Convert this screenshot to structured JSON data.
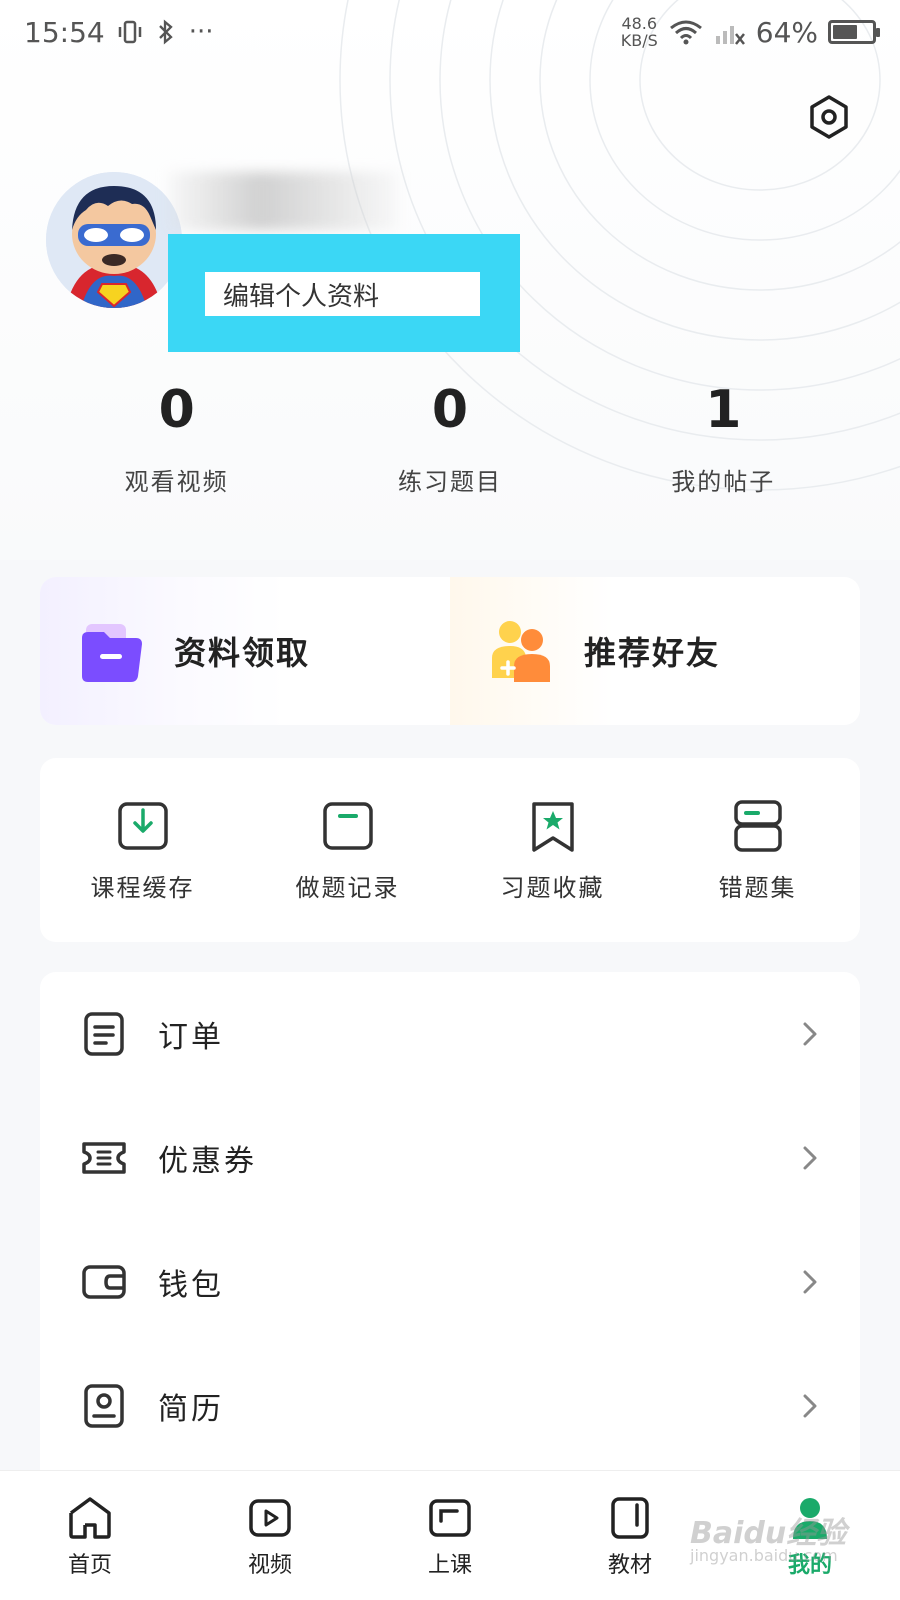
{
  "status_bar": {
    "time": "15:54",
    "more": "···",
    "net_speed_value": "48.6",
    "net_speed_unit": "KB/S",
    "battery_percent": "64%",
    "battery_level": 0.64
  },
  "profile": {
    "edit_label": "编辑个人资料"
  },
  "stats": [
    {
      "value": "0",
      "label": "观看视频"
    },
    {
      "value": "0",
      "label": "练习题目"
    },
    {
      "value": "1",
      "label": "我的帖子"
    }
  ],
  "promos": [
    {
      "label": "资料领取",
      "icon": "folder-icon"
    },
    {
      "label": "推荐好友",
      "icon": "add-friend-icon"
    }
  ],
  "shortcuts": [
    {
      "label": "课程缓存",
      "icon": "download-icon"
    },
    {
      "label": "做题记录",
      "icon": "record-icon"
    },
    {
      "label": "习题收藏",
      "icon": "bookmark-star-icon"
    },
    {
      "label": "错题集",
      "icon": "mistakes-icon"
    }
  ],
  "menu": [
    {
      "label": "订单",
      "icon": "order-icon"
    },
    {
      "label": "优惠券",
      "icon": "coupon-icon"
    },
    {
      "label": "钱包",
      "icon": "wallet-icon"
    },
    {
      "label": "简历",
      "icon": "resume-icon"
    }
  ],
  "tabs": [
    {
      "label": "首页",
      "icon": "home-icon"
    },
    {
      "label": "视频",
      "icon": "video-icon"
    },
    {
      "label": "上课",
      "icon": "class-icon"
    },
    {
      "label": "教材",
      "icon": "textbook-icon"
    },
    {
      "label": "我的",
      "icon": "profile-icon",
      "active": true
    }
  ],
  "colors": {
    "accent_green": "#1aaa6a",
    "highlight_cyan": "#3bd7f5",
    "promo_purple": "#7b4dff",
    "promo_orange": "#ff8c3a"
  },
  "watermark": {
    "main": "Baidu经验",
    "sub": "jingyan.baidu.com"
  }
}
